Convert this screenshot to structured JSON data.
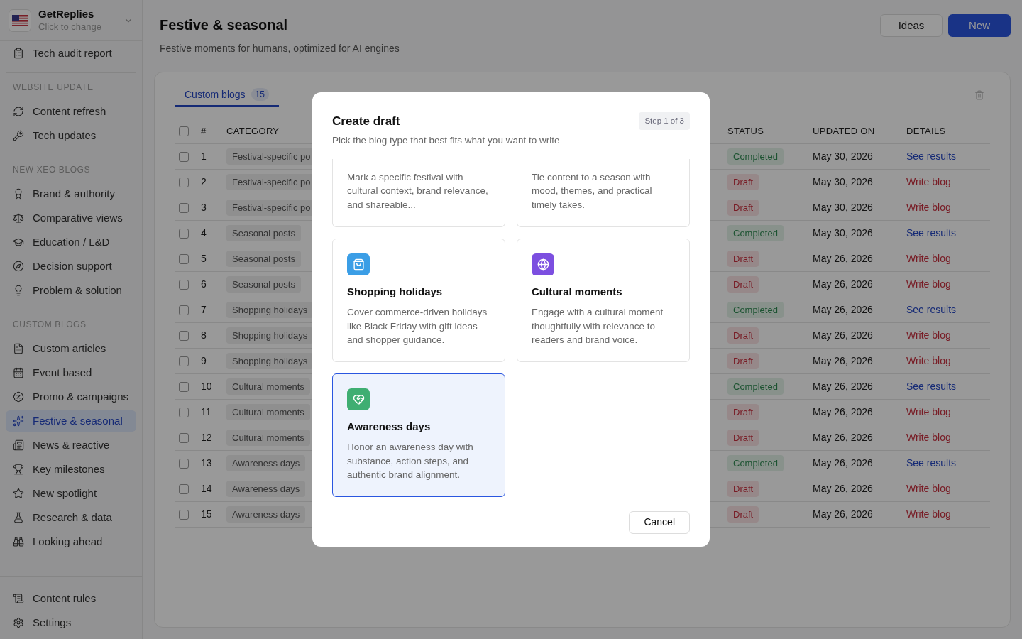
{
  "workspace": {
    "name": "GetReplies",
    "hint": "Click to change"
  },
  "sidebar": {
    "top_items": [
      {
        "label": "Tech audit report",
        "selected": false
      }
    ],
    "sections": [
      {
        "title": "WEBSITE UPDATE",
        "items": [
          {
            "label": "Content refresh",
            "selected": false
          },
          {
            "label": "Tech updates",
            "selected": false
          }
        ]
      },
      {
        "title": "NEW XEO BLOGS",
        "items": [
          {
            "label": "Brand & authority",
            "selected": false
          },
          {
            "label": "Comparative views",
            "selected": false
          },
          {
            "label": "Education / L&D",
            "selected": false
          },
          {
            "label": "Decision support",
            "selected": false
          },
          {
            "label": "Problem & solution",
            "selected": false
          }
        ]
      },
      {
        "title": "CUSTOM BLOGS",
        "items": [
          {
            "label": "Custom articles",
            "selected": false
          },
          {
            "label": "Event based",
            "selected": false
          },
          {
            "label": "Promo & campaigns",
            "selected": false
          },
          {
            "label": "Festive & seasonal",
            "selected": true
          },
          {
            "label": "News & reactive",
            "selected": false
          },
          {
            "label": "Key milestones",
            "selected": false
          },
          {
            "label": "New spotlight",
            "selected": false
          },
          {
            "label": "Research & data",
            "selected": false
          },
          {
            "label": "Looking ahead",
            "selected": false
          }
        ]
      }
    ],
    "bottom_items": [
      {
        "label": "Content rules",
        "selected": false
      },
      {
        "label": "Settings",
        "selected": false
      }
    ]
  },
  "header": {
    "title": "Festive & seasonal",
    "subtitle": "Festive moments for humans, optimized for AI engines",
    "buttons": [
      {
        "label": "Ideas",
        "kind": "secondary"
      },
      {
        "label": "New",
        "kind": "primary"
      }
    ]
  },
  "tabs": [
    {
      "label": "Custom blogs",
      "count": "15",
      "selected": true
    }
  ],
  "table": {
    "select_all_checked": false,
    "columns": [
      "#",
      "CATEGORY",
      "STATUS",
      "UPDATED ON",
      "DETAILS"
    ],
    "rows": [
      {
        "checked": false,
        "number": "1",
        "category": "Festival-specific po",
        "status": "Completed",
        "kind": "completed",
        "updated": "May 30, 2026",
        "details": "See results"
      },
      {
        "checked": false,
        "number": "2",
        "category": "Festival-specific po",
        "status": "Draft",
        "kind": "draft",
        "updated": "May 30, 2026",
        "details": "Write blog"
      },
      {
        "checked": false,
        "number": "3",
        "category": "Festival-specific po",
        "status": "Draft",
        "kind": "draft",
        "updated": "May 30, 2026",
        "details": "Write blog"
      },
      {
        "checked": false,
        "number": "4",
        "category": "Seasonal posts",
        "status": "Completed",
        "kind": "completed",
        "updated": "May 30, 2026",
        "details": "See results"
      },
      {
        "checked": false,
        "number": "5",
        "category": "Seasonal posts",
        "status": "Draft",
        "kind": "draft",
        "updated": "May 26, 2026",
        "details": "Write blog"
      },
      {
        "checked": false,
        "number": "6",
        "category": "Seasonal posts",
        "status": "Draft",
        "kind": "draft",
        "updated": "May 26, 2026",
        "details": "Write blog"
      },
      {
        "checked": false,
        "number": "7",
        "category": "Shopping holidays",
        "status": "Completed",
        "kind": "completed",
        "updated": "May 26, 2026",
        "details": "See results"
      },
      {
        "checked": false,
        "number": "8",
        "category": "Shopping holidays",
        "status": "Draft",
        "kind": "draft",
        "updated": "May 26, 2026",
        "details": "Write blog"
      },
      {
        "checked": false,
        "number": "9",
        "category": "Shopping holidays",
        "status": "Draft",
        "kind": "draft",
        "updated": "May 26, 2026",
        "details": "Write blog"
      },
      {
        "checked": false,
        "number": "10",
        "category": "Cultural moments",
        "status": "Completed",
        "kind": "completed",
        "updated": "May 26, 2026",
        "details": "See results"
      },
      {
        "checked": false,
        "number": "11",
        "category": "Cultural moments",
        "status": "Draft",
        "kind": "draft",
        "updated": "May 26, 2026",
        "details": "Write blog"
      },
      {
        "checked": false,
        "number": "12",
        "category": "Cultural moments",
        "status": "Draft",
        "kind": "draft",
        "updated": "May 26, 2026",
        "details": "Write blog"
      },
      {
        "checked": false,
        "number": "13",
        "category": "Awareness days",
        "status": "Completed",
        "kind": "completed",
        "updated": "May 26, 2026",
        "details": "See results"
      },
      {
        "checked": false,
        "number": "14",
        "category": "Awareness days",
        "status": "Draft",
        "kind": "draft",
        "updated": "May 26, 2026",
        "details": "Write blog"
      },
      {
        "checked": false,
        "number": "15",
        "category": "Awareness days",
        "status": "Draft",
        "kind": "draft",
        "updated": "May 26, 2026",
        "details": "Write blog"
      }
    ]
  },
  "dialog": {
    "title": "Create draft",
    "subtitle": "Pick the blog type that best fits what you want to write",
    "step": "Step 1 of 3",
    "cards": [
      {
        "kind": "clipped",
        "description": "Mark a specific festival with cultural context, brand relevance, and shareable...",
        "selected": false
      },
      {
        "kind": "clipped",
        "description": "Tie content to a season with mood, themes, and practical timely takes.",
        "selected": false
      },
      {
        "kind": "full",
        "title": "Shopping holidays",
        "description": "Cover commerce-driven holidays like Black Friday with gift ideas and shopper guidance.",
        "color": "#3b9ee6",
        "selected": false
      },
      {
        "kind": "full",
        "title": "Cultural moments",
        "description": "Engage with a cultural moment thoughtfully with relevance to readers and brand voice.",
        "color": "#7c4fe0",
        "selected": false
      },
      {
        "kind": "full",
        "title": "Awareness days",
        "description": "Honor an awareness day with substance, action steps, and authentic brand alignment.",
        "color": "#3fae72",
        "selected": true
      }
    ],
    "cancel": "Cancel"
  }
}
